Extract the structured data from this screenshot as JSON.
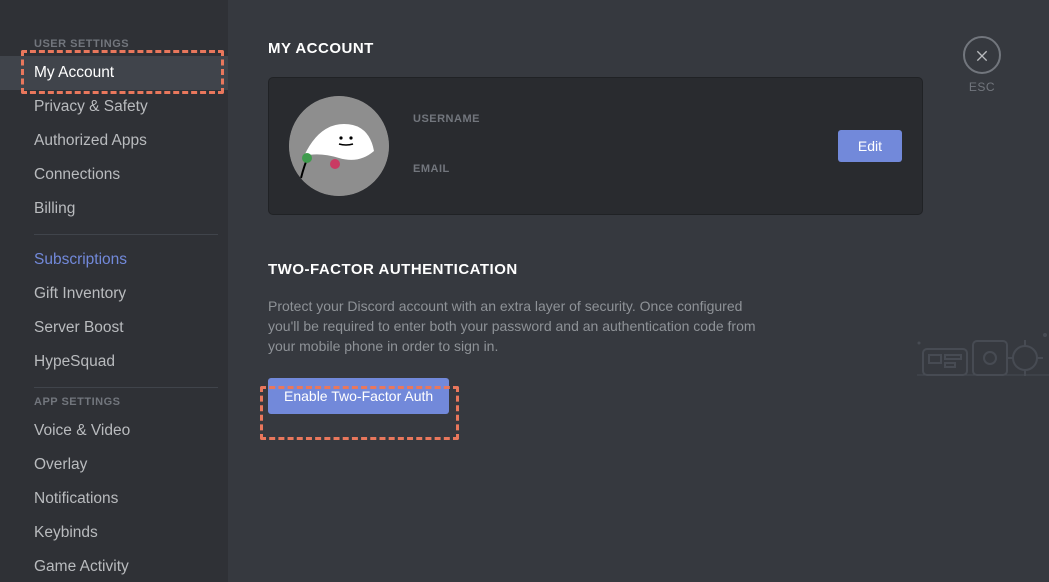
{
  "sidebar": {
    "heading_user": "USER SETTINGS",
    "heading_app": "APP SETTINGS",
    "user_items": [
      {
        "label": "My Account",
        "selected": true
      },
      {
        "label": "Privacy & Safety"
      },
      {
        "label": "Authorized Apps"
      },
      {
        "label": "Connections"
      },
      {
        "label": "Billing"
      }
    ],
    "user_items2": [
      {
        "label": "Subscriptions",
        "link": true
      },
      {
        "label": "Gift Inventory"
      },
      {
        "label": "Server Boost"
      },
      {
        "label": "HypeSquad"
      }
    ],
    "app_items": [
      {
        "label": "Voice & Video"
      },
      {
        "label": "Overlay"
      },
      {
        "label": "Notifications"
      },
      {
        "label": "Keybinds"
      },
      {
        "label": "Game Activity"
      }
    ]
  },
  "close": {
    "label": "ESC"
  },
  "page": {
    "title": "MY ACCOUNT"
  },
  "account": {
    "username_label": "USERNAME",
    "email_label": "EMAIL",
    "edit_label": "Edit"
  },
  "twofa": {
    "title": "TWO-FACTOR AUTHENTICATION",
    "description": "Protect your Discord account with an extra layer of security. Once configured you'll be required to enter both your password and an authentication code from your mobile phone in order to sign in.",
    "button_label": "Enable Two-Factor Auth"
  },
  "colors": {
    "accent": "#7289da",
    "highlight": "#e9775c"
  }
}
